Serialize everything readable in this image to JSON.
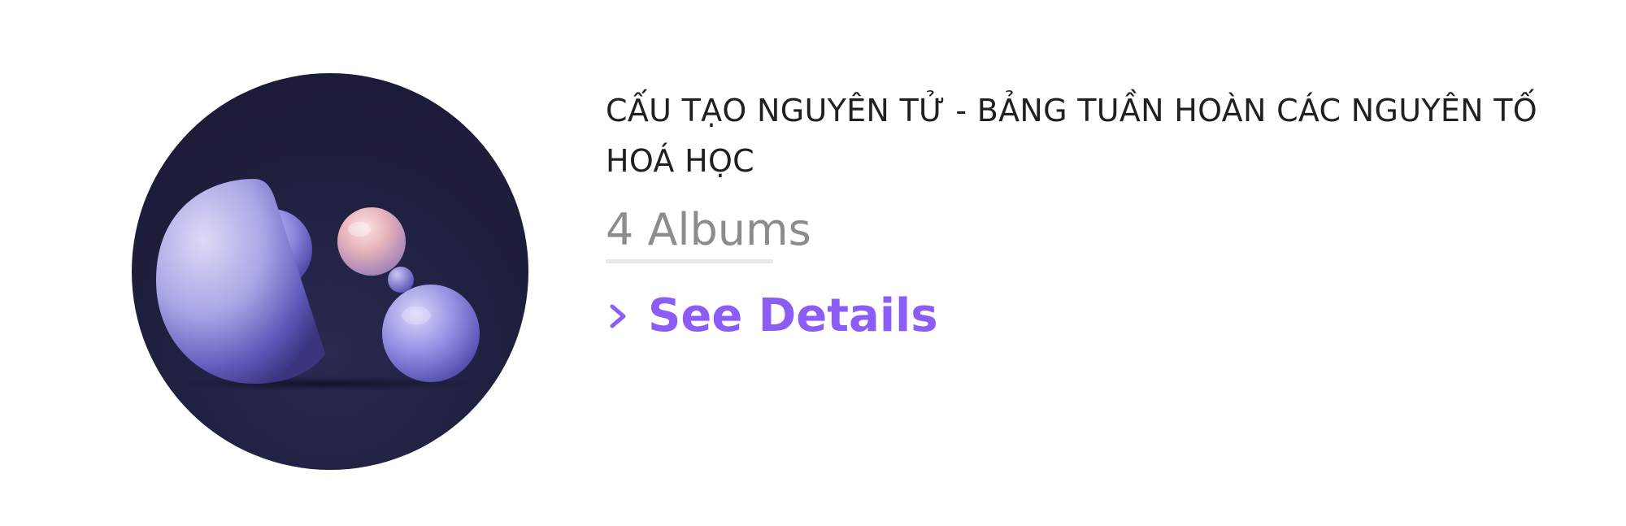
{
  "album": {
    "title": "CẤU TẠO NGUYÊN TỬ - BẢNG TUẦN HOÀN CÁC NGUYÊN TỐ HOÁ HỌC",
    "count_label": "4 Albums",
    "details_label": "See Details",
    "accent_color": "#8b5cf6",
    "cover_background": "#1e1e3d"
  },
  "icons": {
    "details": "chevron-right-icon",
    "cover": "abstract-spheres-image"
  }
}
